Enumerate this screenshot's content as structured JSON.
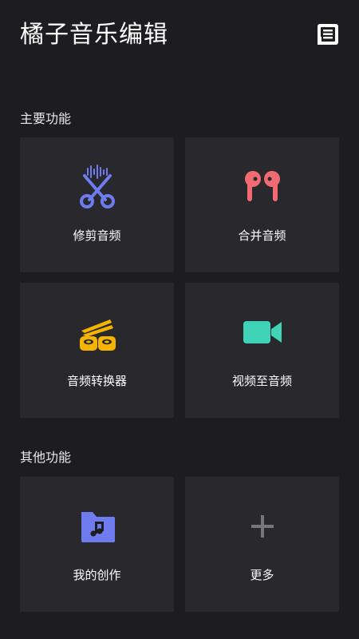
{
  "app": {
    "title": "橘子音乐编辑"
  },
  "header": {
    "doc_icon": "document-icon"
  },
  "sections": [
    {
      "title": "主要功能",
      "items": [
        {
          "label": "修剪音频",
          "icon": "scissors-audio-icon",
          "color": "#6f7cf0"
        },
        {
          "label": "合并音频",
          "icon": "earbuds-icon",
          "color": "#f26b73"
        },
        {
          "label": "音频转换器",
          "icon": "sushi-convert-icon",
          "color": "#f4b400"
        },
        {
          "label": "视频至音频",
          "icon": "video-camera-icon",
          "color": "#3fd3b8"
        }
      ]
    },
    {
      "title": "其他功能",
      "items": [
        {
          "label": "我的创作",
          "icon": "music-folder-icon",
          "color": "#6f7cf0"
        },
        {
          "label": "更多",
          "icon": "plus-icon",
          "color": "#777777"
        }
      ]
    }
  ]
}
